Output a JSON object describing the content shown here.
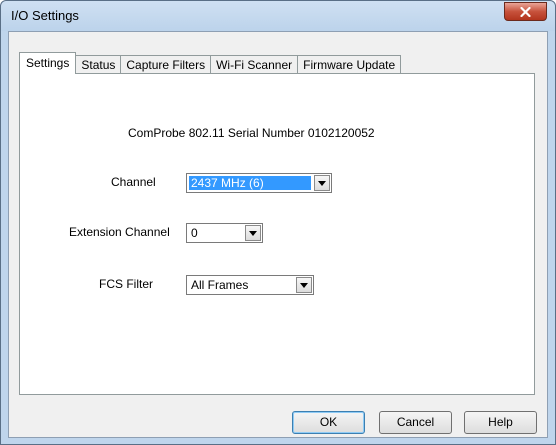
{
  "window": {
    "title": "I/O Settings"
  },
  "tabs": [
    {
      "label": "Settings"
    },
    {
      "label": "Status"
    },
    {
      "label": "Capture Filters"
    },
    {
      "label": "Wi-Fi Scanner"
    },
    {
      "label": "Firmware Update"
    }
  ],
  "settings": {
    "serial_text": "ComProbe 802.11 Serial Number 0102120052",
    "channel": {
      "label": "Channel",
      "value": "2437 MHz (6)"
    },
    "extension_channel": {
      "label": "Extension Channel",
      "value": "0"
    },
    "fcs_filter": {
      "label": "FCS Filter",
      "value": "All Frames"
    }
  },
  "buttons": {
    "ok": "OK",
    "cancel": "Cancel",
    "help": "Help"
  },
  "icons": {
    "close": "close-icon",
    "dropdown": "chevron-down-icon"
  },
  "colors": {
    "selection": "#3399ff",
    "close_button": "#c7523c"
  }
}
